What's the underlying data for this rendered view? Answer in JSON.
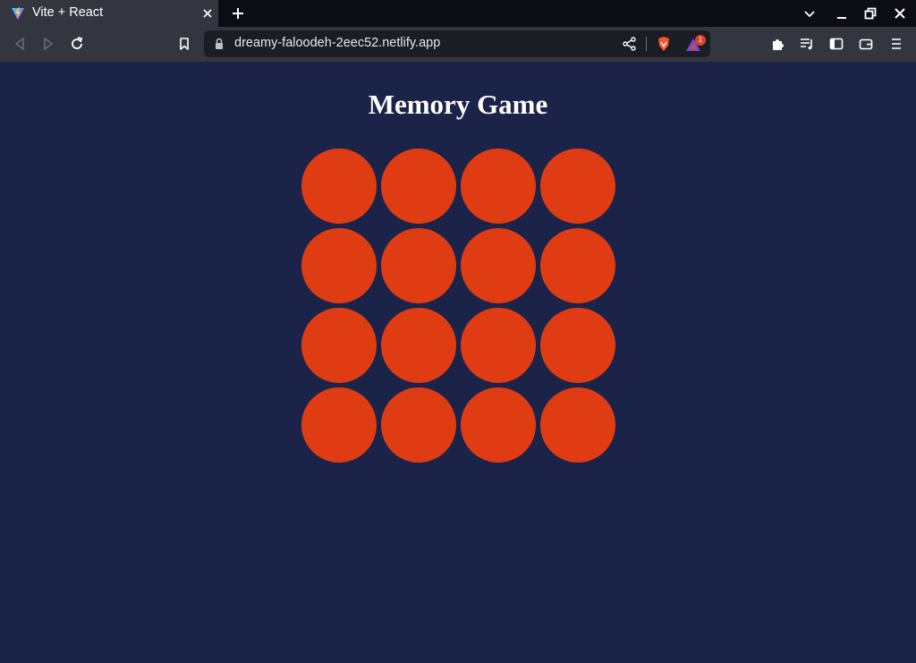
{
  "browser": {
    "tab": {
      "title": "Vite + React",
      "favicon": "vite-logo-icon"
    },
    "address": {
      "url": "dreamy-faloodeh-2eec52.netlify.app"
    },
    "rewards_badge": "1"
  },
  "app": {
    "title": "Memory Game",
    "card_color": "#e03c14",
    "background_color": "#1b2349",
    "grid": {
      "rows": 4,
      "columns": 4
    },
    "cards": [
      {
        "state": "face-down"
      },
      {
        "state": "face-down"
      },
      {
        "state": "face-down"
      },
      {
        "state": "face-down"
      },
      {
        "state": "face-down"
      },
      {
        "state": "face-down"
      },
      {
        "state": "face-down"
      },
      {
        "state": "face-down"
      },
      {
        "state": "face-down"
      },
      {
        "state": "face-down"
      },
      {
        "state": "face-down"
      },
      {
        "state": "face-down"
      },
      {
        "state": "face-down"
      },
      {
        "state": "face-down"
      },
      {
        "state": "face-down"
      },
      {
        "state": "face-down"
      }
    ]
  }
}
